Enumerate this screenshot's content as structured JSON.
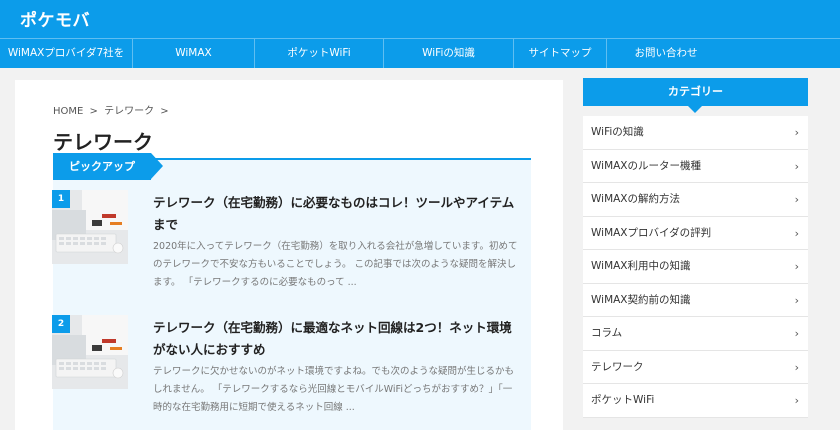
{
  "site": {
    "logo": "ポケモバ"
  },
  "nav": {
    "items": [
      {
        "label": "WiMAXプロバイダ7社を"
      },
      {
        "label": "WiMAX"
      },
      {
        "label": "ポケットWiFi"
      },
      {
        "label": "WiFiの知識"
      },
      {
        "label": "サイトマップ"
      },
      {
        "label": "お問い合わせ"
      }
    ]
  },
  "breadcrumb": {
    "home": "HOME",
    "sep": ">",
    "current": "テレワーク"
  },
  "page": {
    "title": "テレワーク",
    "pickup_label": "ピックアップ"
  },
  "articles": [
    {
      "num": "1",
      "title": "テレワーク（在宅勤務）に必要なものはコレ！ツールやアイテムまで",
      "excerpt": "2020年に入ってテレワーク（在宅勤務）を取り入れる会社が急増しています。初めてのテレワークで不安な方もいることでしょう。 この記事では次のような疑問を解決します。 「テレワークするのに必要なものって ..."
    },
    {
      "num": "2",
      "title": "テレワーク（在宅勤務）に最適なネット回線は2つ！ネット環境がない人におすすめ",
      "excerpt": "テレワークに欠かせないのがネット環境ですよね。でも次のような疑問が生じるかもしれません。 「テレワークするなら光回線とモバイルWiFiどっちがおすすめ？」「一時的な在宅勤務用に短期で使えるネット回線 ..."
    }
  ],
  "sidebar": {
    "heading": "カテゴリー",
    "chevron": "›",
    "items": [
      {
        "label": "WiFiの知識"
      },
      {
        "label": "WiMAXのルーター機種"
      },
      {
        "label": "WiMAXの解約方法"
      },
      {
        "label": "WiMAXプロバイダの評判"
      },
      {
        "label": "WiMAX利用中の知識"
      },
      {
        "label": "WiMAX契約前の知識"
      },
      {
        "label": "コラム"
      },
      {
        "label": "テレワーク"
      },
      {
        "label": "ポケットWiFi"
      }
    ]
  },
  "colors": {
    "accent": "#0c9cea",
    "panel": "#eef8fe"
  }
}
